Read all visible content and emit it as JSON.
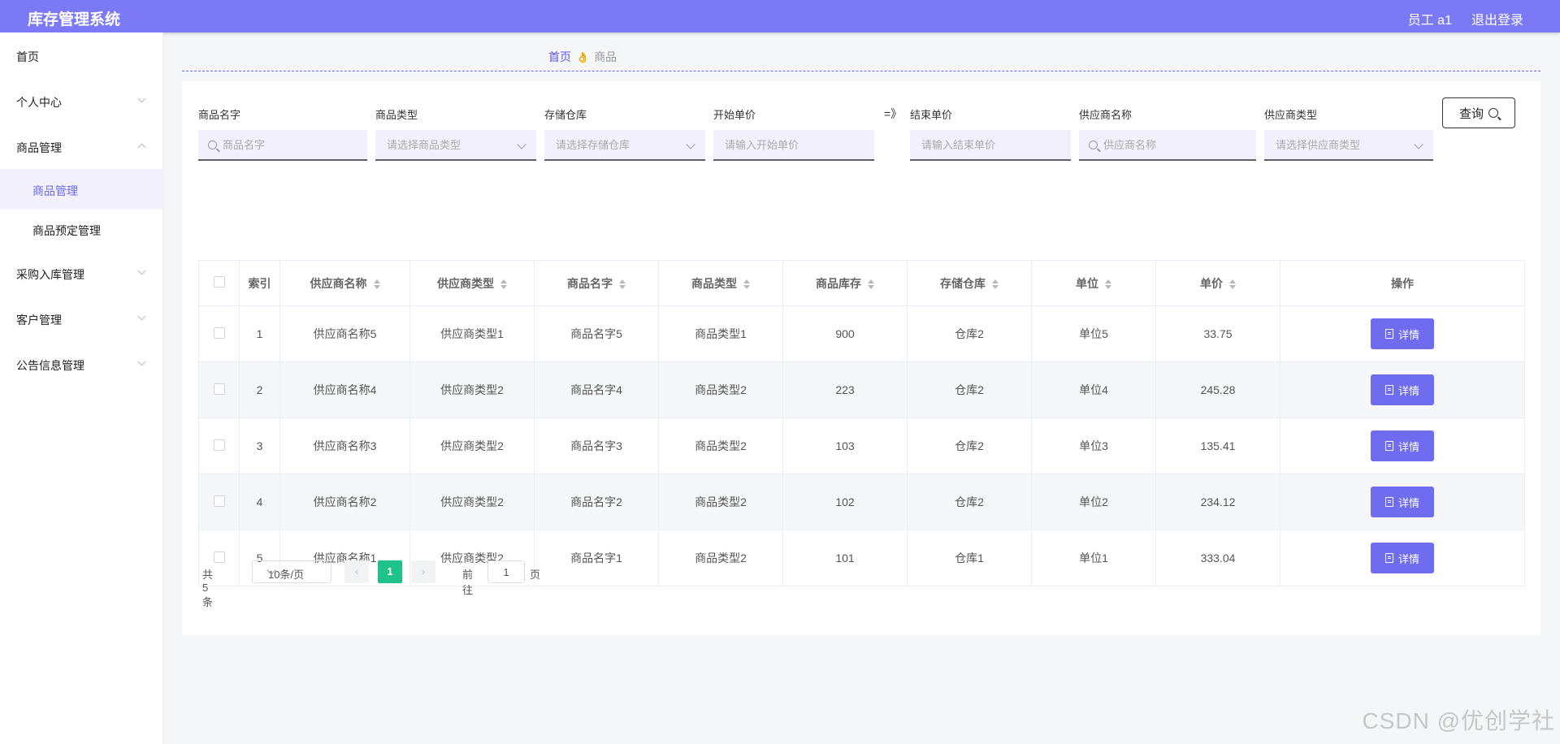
{
  "header": {
    "app_title": "库存管理系统",
    "user_label": "员工 a1",
    "logout_label": "退出登录"
  },
  "sidebar": {
    "items": [
      {
        "label": "首页"
      },
      {
        "label": "个人中心"
      },
      {
        "label": "商品管理"
      },
      {
        "label": "商品管理"
      },
      {
        "label": "商品预定管理"
      },
      {
        "label": "采购入库管理"
      },
      {
        "label": "客户管理"
      },
      {
        "label": "公告信息管理"
      }
    ]
  },
  "breadcrumb": {
    "home": "首页",
    "separator": "👌",
    "current": "商品"
  },
  "filters": {
    "goods_name": {
      "label": "商品名字",
      "placeholder": "商品名字"
    },
    "goods_type": {
      "label": "商品类型",
      "placeholder": "请选择商品类型"
    },
    "warehouse": {
      "label": "存储仓库",
      "placeholder": "请选择存储仓库"
    },
    "price_start": {
      "label": "开始单价",
      "placeholder": "请输入开始单价"
    },
    "range_sep": "=》",
    "price_end": {
      "label": "结束单价",
      "placeholder": "请输入结束单价"
    },
    "supplier_name": {
      "label": "供应商名称",
      "placeholder": "供应商名称"
    },
    "supplier_type": {
      "label": "供应商类型",
      "placeholder": "请选择供应商类型"
    },
    "query_label": "查询"
  },
  "table": {
    "headers": {
      "index": "索引",
      "supplier_name": "供应商名称",
      "supplier_type": "供应商类型",
      "goods_name": "商品名字",
      "goods_type": "商品类型",
      "stock": "商品库存",
      "warehouse": "存储仓库",
      "unit": "单位",
      "price": "单价",
      "action": "操作"
    },
    "detail_label": "详情",
    "rows": [
      {
        "index": "1",
        "supplier_name": "供应商名称5",
        "supplier_type": "供应商类型1",
        "goods_name": "商品名字5",
        "goods_type": "商品类型1",
        "stock": "900",
        "warehouse": "仓库2",
        "unit": "单位5",
        "price": "33.75"
      },
      {
        "index": "2",
        "supplier_name": "供应商名称4",
        "supplier_type": "供应商类型2",
        "goods_name": "商品名字4",
        "goods_type": "商品类型2",
        "stock": "223",
        "warehouse": "仓库2",
        "unit": "单位4",
        "price": "245.28"
      },
      {
        "index": "3",
        "supplier_name": "供应商名称3",
        "supplier_type": "供应商类型2",
        "goods_name": "商品名字3",
        "goods_type": "商品类型2",
        "stock": "103",
        "warehouse": "仓库2",
        "unit": "单位3",
        "price": "135.41"
      },
      {
        "index": "4",
        "supplier_name": "供应商名称2",
        "supplier_type": "供应商类型2",
        "goods_name": "商品名字2",
        "goods_type": "商品类型2",
        "stock": "102",
        "warehouse": "仓库2",
        "unit": "单位2",
        "price": "234.12"
      },
      {
        "index": "5",
        "supplier_name": "供应商名称1",
        "supplier_type": "供应商类型2",
        "goods_name": "商品名字1",
        "goods_type": "商品类型2",
        "stock": "101",
        "warehouse": "仓库1",
        "unit": "单位1",
        "price": "333.04"
      }
    ]
  },
  "pagination": {
    "total_label": "共 5 条",
    "page_size": "10条/页",
    "current_page": "1",
    "goto_label": "前往",
    "goto_value": "1",
    "page_unit": "页"
  },
  "watermark": "CSDN @优创学社",
  "colors": {
    "header_bg": "#7b79f6",
    "accent": "#6f6cf0",
    "page_active": "#1ec28b"
  }
}
